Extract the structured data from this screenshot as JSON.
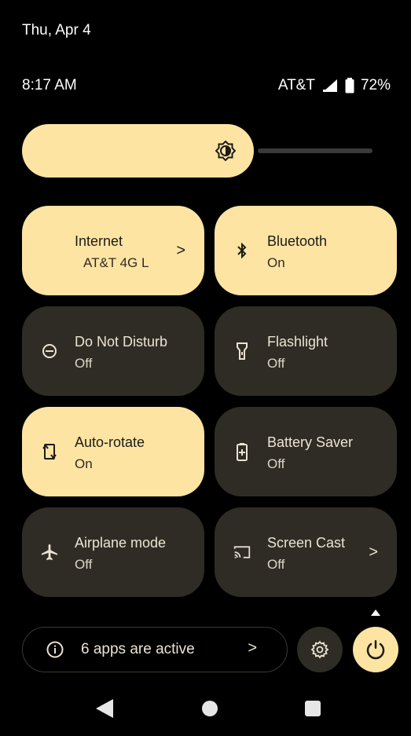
{
  "status": {
    "date": "Thu, Apr 4",
    "time": "8:17 AM",
    "carrier": "AT&T",
    "battery": "72%"
  },
  "brightness": {
    "level": 0.6,
    "icon": "brightness-icon"
  },
  "tiles": [
    {
      "title": "Internet",
      "subtitle": "AT&T 4G L",
      "state": "on",
      "icon": "none",
      "chevron": ">"
    },
    {
      "title": "Bluetooth",
      "subtitle": "On",
      "state": "on",
      "icon": "bluetooth-icon"
    },
    {
      "title": "Do Not Disturb",
      "subtitle": "Off",
      "state": "off",
      "icon": "do-not-disturb-icon"
    },
    {
      "title": "Flashlight",
      "subtitle": "Off",
      "state": "off",
      "icon": "flashlight-icon"
    },
    {
      "title": "Auto-rotate",
      "subtitle": "On",
      "state": "on",
      "icon": "auto-rotate-icon"
    },
    {
      "title": "Battery Saver",
      "subtitle": "Off",
      "state": "off",
      "icon": "battery-saver-icon"
    },
    {
      "title": "Airplane mode",
      "subtitle": "Off",
      "state": "off",
      "icon": "airplane-icon"
    },
    {
      "title": "Screen Cast",
      "subtitle": "Off",
      "state": "off",
      "icon": "screen-cast-icon",
      "chevron": ">"
    }
  ],
  "footer": {
    "apps_active": "6 apps are active",
    "chevron": ">"
  },
  "colors": {
    "tile_on": "#fde4a3",
    "tile_off": "#2f2c26",
    "background": "#000000"
  }
}
